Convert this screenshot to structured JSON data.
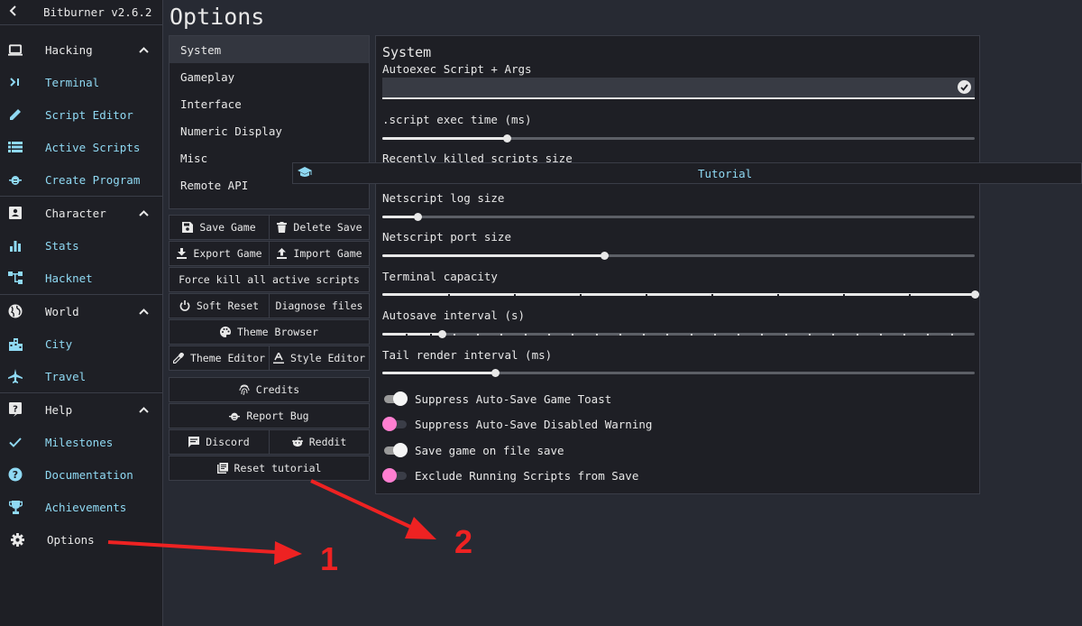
{
  "app": {
    "title": "Bitburner v2.6.2"
  },
  "colors": {
    "accent": "#8fd9f3",
    "toggle_off": "#ff7fd1",
    "background": "#272a33",
    "panel": "#1e1f25",
    "annotation": "#ee2222"
  },
  "sidebar": {
    "collapse_icon": "chevron-left-icon",
    "groups": [
      {
        "label": "Hacking",
        "icon": "laptop-icon",
        "items": [
          {
            "label": "Terminal",
            "icon": "terminal-icon"
          },
          {
            "label": "Script Editor",
            "icon": "pencil-icon"
          },
          {
            "label": "Active Scripts",
            "icon": "list-icon"
          },
          {
            "label": "Create Program",
            "icon": "bug-icon"
          }
        ]
      },
      {
        "label": "Character",
        "icon": "contact-card-icon",
        "items": [
          {
            "label": "Stats",
            "icon": "bar-chart-icon"
          },
          {
            "label": "Hacknet",
            "icon": "network-icon"
          }
        ]
      },
      {
        "label": "World",
        "icon": "globe-icon",
        "items": [
          {
            "label": "City",
            "icon": "city-icon"
          },
          {
            "label": "Travel",
            "icon": "airplane-icon"
          }
        ]
      },
      {
        "label": "Help",
        "icon": "help-icon",
        "items": [
          {
            "label": "Milestones",
            "icon": "check-icon"
          },
          {
            "label": "Documentation",
            "icon": "question-circle-icon"
          },
          {
            "label": "Achievements",
            "icon": "trophy-icon"
          }
        ]
      }
    ],
    "options": {
      "label": "Options",
      "icon": "gear-icon"
    }
  },
  "page": {
    "title": "Options"
  },
  "tabs": [
    "System",
    "Gameplay",
    "Interface",
    "Numeric Display",
    "Misc",
    "Remote API"
  ],
  "actions": {
    "save_game": "Save Game",
    "delete_save": "Delete Save",
    "export_game": "Export Game",
    "import_game": "Import Game",
    "force_kill": "Force kill all active scripts",
    "soft_reset": "Soft Reset",
    "diagnose": "Diagnose files",
    "theme_browser": "Theme Browser",
    "theme_editor": "Theme Editor",
    "style_editor": "Style Editor",
    "credits": "Credits",
    "report_bug": "Report Bug",
    "discord": "Discord",
    "reddit": "Reddit",
    "reset_tutorial": "Reset tutorial"
  },
  "system": {
    "heading": "System",
    "autoexec_label": "Autoexec Script + Args",
    "autoexec_value": "",
    "sliders": [
      {
        "label": ".script exec time (ms)",
        "fraction": 0.21
      },
      {
        "label": "Recently killed scripts size"
      },
      {
        "label": "Netscript log size",
        "fraction": 0.06
      },
      {
        "label": "Netscript port size",
        "fraction": 0.375
      },
      {
        "label": "Terminal capacity",
        "fraction": 1.0
      },
      {
        "label": "Autosave interval (s)",
        "fraction": 0.1
      },
      {
        "label": "Tail render interval (ms)",
        "fraction": 0.19
      }
    ],
    "toggles": [
      {
        "label": "Suppress Auto-Save Game Toast",
        "on": true
      },
      {
        "label": "Suppress Auto-Save Disabled Warning",
        "on": false
      },
      {
        "label": "Save game on file save",
        "on": true
      },
      {
        "label": "Exclude Running Scripts from Save",
        "on": false
      }
    ]
  },
  "tutorial": {
    "label": "Tutorial",
    "icon": "graduation-cap-icon"
  },
  "annotations": {
    "arrow1": "1",
    "arrow2": "2"
  }
}
